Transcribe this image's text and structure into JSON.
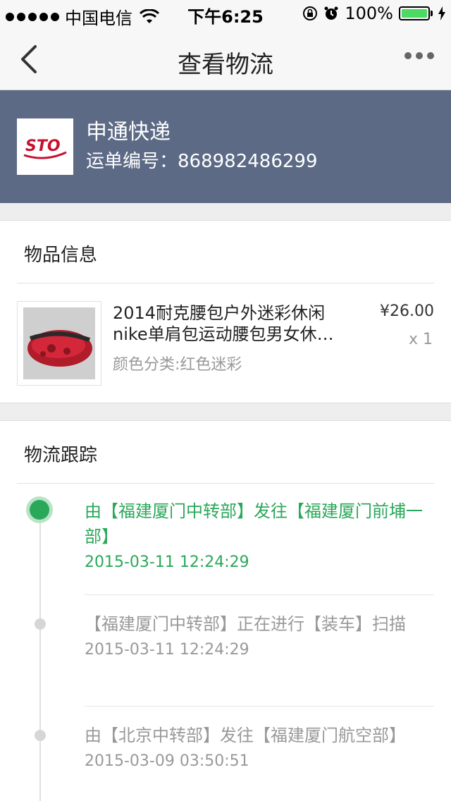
{
  "status_bar": {
    "carrier": "中国电信",
    "time": "下午6:25",
    "battery": "100%"
  },
  "nav": {
    "title": "查看物流"
  },
  "carrier_info": {
    "logo_text": "STO",
    "name": "申通快递",
    "waybill": "运单编号：868982486299"
  },
  "goods": {
    "section_title": "物品信息",
    "name_line1": "2014耐克腰包户外迷彩休闲",
    "name_line2": "nike单肩包运动腰包男女休…",
    "variant": "颜色分类:红色迷彩",
    "price": "¥26.00",
    "qty": "x 1"
  },
  "tracking": {
    "section_title": "物流跟踪",
    "events": [
      {
        "text": "由【福建厦门中转部】发往【福建厦门前埔一部】",
        "time": "2015-03-11 12:24:29",
        "active": true
      },
      {
        "text": "【福建厦门中转部】正在进行【装车】扫描",
        "time": "2015-03-11 12:24:29",
        "active": false
      },
      {
        "text": "由【北京中转部】发往【福建厦门航空部】",
        "time": "2015-03-09 03:50:51",
        "active": false
      }
    ]
  },
  "colors": {
    "accent_green": "#2aa85a",
    "header_bg": "#5c6a85",
    "sto_red": "#c8102e"
  }
}
